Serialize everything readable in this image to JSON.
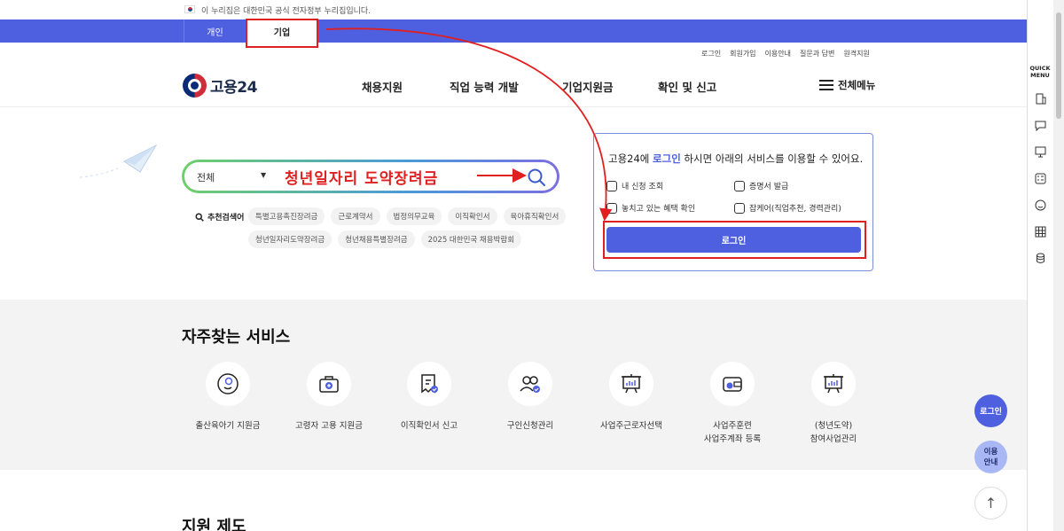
{
  "gov_banner": {
    "text": "이 누리집은 대한민국 공식 전자정부 누리집입니다."
  },
  "tabs": [
    {
      "label": "개인"
    },
    {
      "label": "기업"
    }
  ],
  "util_links": [
    "로그인",
    "회원가입",
    "이용안내",
    "질문과 답변",
    "원격지원"
  ],
  "header": {
    "logo_text": "고용24",
    "nav": [
      "채용지원",
      "직업 능력 개발",
      "기업지원금",
      "확인 및 신고"
    ],
    "all_menu": "전체메뉴"
  },
  "search": {
    "category": "전체",
    "typed_text": "청년일자리 도약장려금",
    "recommend_label": "추천검색어",
    "keywords_row1": [
      "특별고용촉진장려금",
      "근로계약서",
      "법정의무교육",
      "이직확인서",
      "육아휴직확인서"
    ],
    "keywords_row2": [
      "청년일자리도약장려금",
      "청년채용특별장려금",
      "2025 대한민국 채용박람회"
    ]
  },
  "login_panel": {
    "msg_prefix": "고용24에 ",
    "msg_accent": "로그인",
    "msg_suffix": " 하시면 아래의 서비스를 이용할 수 있어요.",
    "services": [
      "내 신청 조회",
      "증명서 발급",
      "놓치고 있는 혜택 확인",
      "잡케어(직업추천, 경력관리)"
    ],
    "button": "로그인"
  },
  "favorites": {
    "title": "자주찾는 서비스",
    "items": [
      {
        "l1": "출산육아기 지원금",
        "l2": ""
      },
      {
        "l1": "고령자 고용 지원금",
        "l2": ""
      },
      {
        "l1": "이직확인서 신고",
        "l2": ""
      },
      {
        "l1": "구인신청관리",
        "l2": ""
      },
      {
        "l1": "사업주근로자선택",
        "l2": ""
      },
      {
        "l1": "사업주훈련",
        "l2": "사업주계좌 등록"
      },
      {
        "l1": "(청년도약)",
        "l2": "참여사업관리"
      }
    ]
  },
  "next_section": {
    "title": "지원 제도"
  },
  "quick_menu": {
    "title_l1": "QUICK",
    "title_l2": "MENU"
  },
  "floating": {
    "login": "로그인",
    "guide_l1": "이용",
    "guide_l2": "안내",
    "top": "↑"
  },
  "colors": {
    "primary": "#4e5fe0",
    "highlight": "#e02020"
  }
}
